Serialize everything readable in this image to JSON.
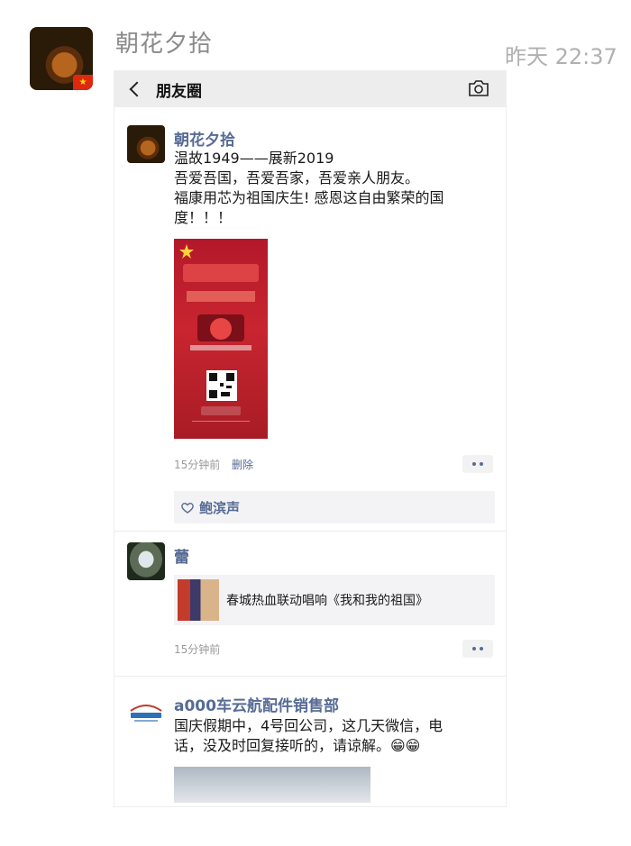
{
  "chat": {
    "sender_name": "朝花夕拾",
    "time": "昨天 22:37"
  },
  "moments_screen": {
    "title": "朋友圈",
    "icons": {
      "back": "back-chevron-icon",
      "camera": "camera-icon",
      "like": "heart-icon",
      "more": "more-dots-icon"
    },
    "posts": [
      {
        "author": "朝花夕拾",
        "lines": [
          "温故1949——展新2019",
          "吾爱吾国，吾爱吾家，吾爱亲人朋友。",
          "福康用芯为祖国庆生! 感恩这自由繁荣的国",
          "度！！！"
        ],
        "time": "15分钟前",
        "delete_label": "删除",
        "likes": "鲍滨声"
      },
      {
        "author": "蕾",
        "share_title": "春城热血联动唱响《我和我的祖国》",
        "time": "15分钟前"
      },
      {
        "author": "a000车云航配件销售部",
        "lines": [
          "国庆假期中，4号回公司，这几天微信，电",
          "话，没及时回复接听的，请谅解。😁😁"
        ]
      }
    ]
  },
  "colors": {
    "link_blue": "#576b95",
    "poster_red": "#c8252f",
    "timestamp_grey": "#b0b0b0"
  }
}
